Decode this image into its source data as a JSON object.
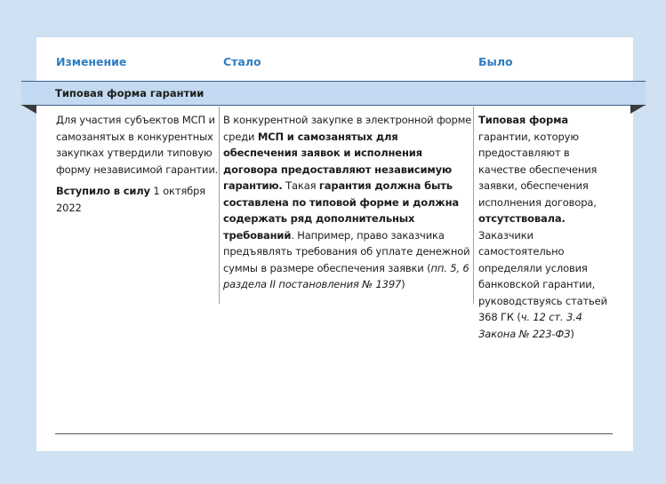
{
  "headers": {
    "change": "Изменение",
    "became": "Стало",
    "was": "Было"
  },
  "section_title": "Типовая форма гарантии",
  "change_col": {
    "text": "Для участия субъектов МСП и самозанятых в конкурентных закупках утвердили типовую форму независимой гарантии.",
    "effective_label": "Вступило в силу",
    "effective_date": " 1 октября 2022"
  },
  "became_col": {
    "t1": "В конкурентной закупке в электронной форме среди ",
    "b1": "МСП и самозанятых для обеспечения заявок и исполнения договора предоставляют независимую гарантию.",
    "t2": " Такая ",
    "b2": "гарантия должна быть составлена по типовой форме и должна содержать ряд дополнительных требований",
    "t3": ". Например, право заказчика предъявлять требования об уплате денежной суммы в размере обеспечения заявки (",
    "i1": "пп. 5, 6 раздела II постановления № 1397",
    "t4": ")"
  },
  "was_col": {
    "b1": "Типовая форма",
    "t1": " гарантии, которую предоставляют в качестве обеспечения заявки, обеспечения исполнения договора, ",
    "b2": "отсутствовала.",
    "t2": " Заказчики самостоятельно определяли условия банковской гарантии, руководствуясь статьей 368 ГК (",
    "i1": "ч. 12 ст. 3.4 Закона № 223-ФЗ",
    "t3": ")"
  }
}
